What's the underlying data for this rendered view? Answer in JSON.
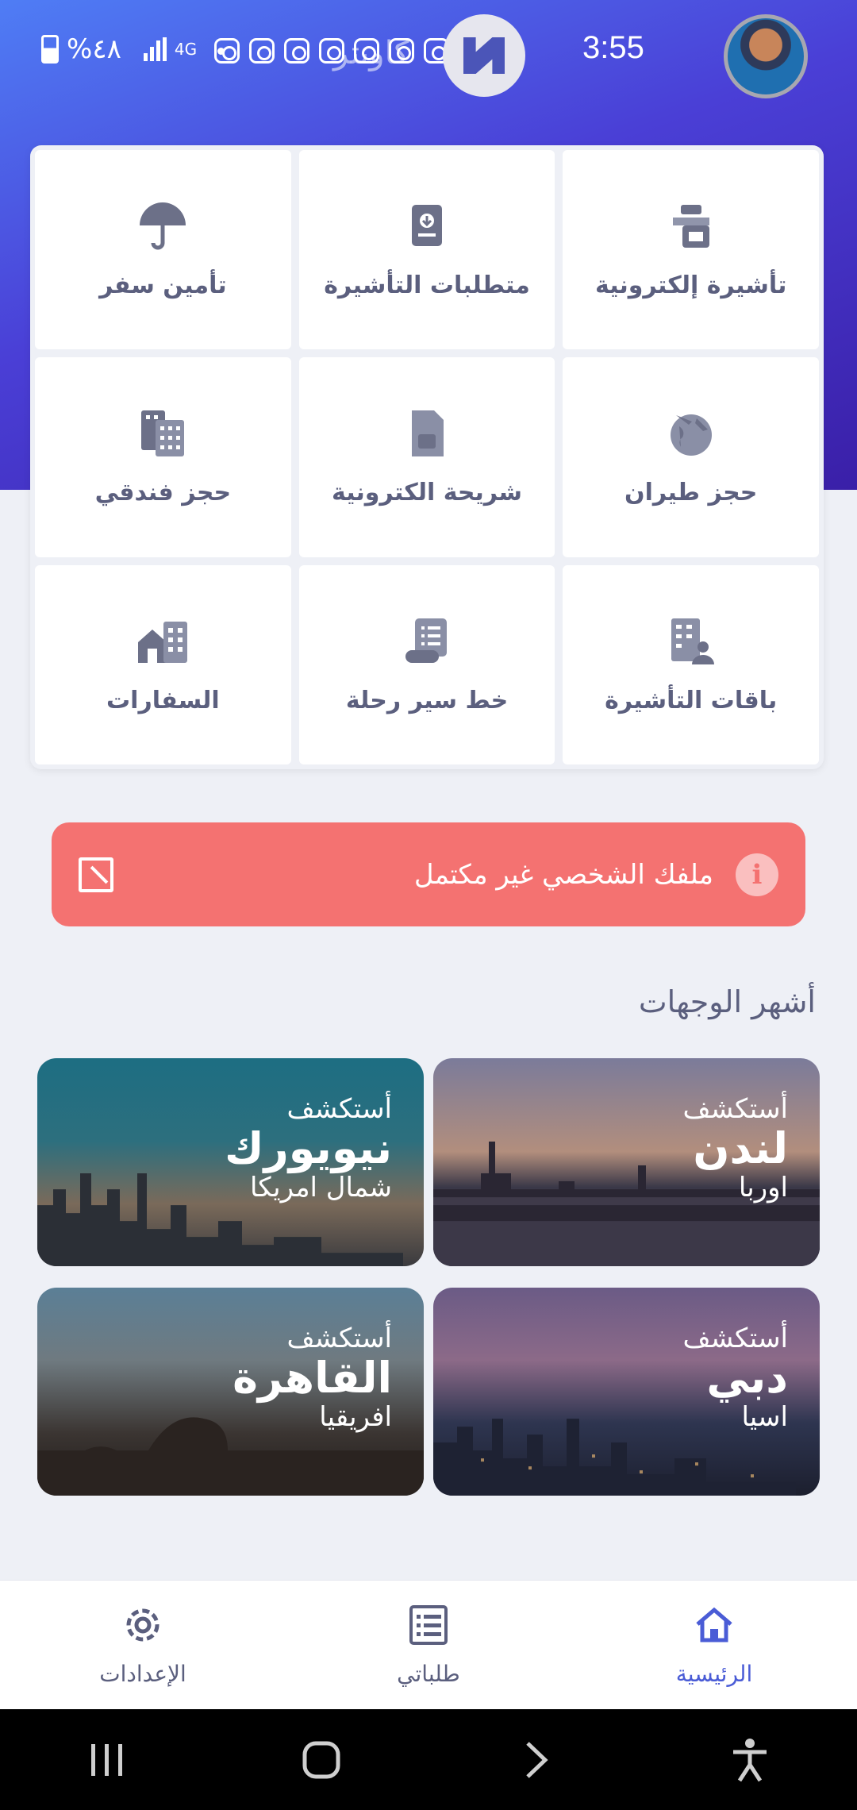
{
  "status_bar": {
    "time": "3:55",
    "battery": "%٤٨",
    "network": "4G"
  },
  "brand_ghost": "كاونتر",
  "services": [
    {
      "label": "تأشيرة إلكترونية",
      "icon": "visa-officer-icon"
    },
    {
      "label": "متطلبات التأشيرة",
      "icon": "passport-icon"
    },
    {
      "label": "تأمين سفر",
      "icon": "umbrella-icon"
    },
    {
      "label": "حجز طيران",
      "icon": "globe-plane-icon"
    },
    {
      "label": "شريحة الكترونية",
      "icon": "sim-card-icon"
    },
    {
      "label": "حجز فندقي",
      "icon": "hotel-icon"
    },
    {
      "label": "باقات التأشيرة",
      "icon": "building-user-icon"
    },
    {
      "label": "خط سير رحلة",
      "icon": "itinerary-icon"
    },
    {
      "label": "السفارات",
      "icon": "embassy-icon"
    }
  ],
  "alert": {
    "text": "ملفك الشخصي غير مكتمل",
    "info_glyph": "i",
    "color": "#f47271"
  },
  "popular": {
    "title": "أشهر الوجهات",
    "destinations": [
      {
        "explore": "أستكشف",
        "city": "لندن",
        "region": "اوربا"
      },
      {
        "explore": "أستكشف",
        "city": "نيويورك",
        "region": "شمال امريكا"
      },
      {
        "explore": "أستكشف",
        "city": "دبي",
        "region": "اسيا"
      },
      {
        "explore": "أستكشف",
        "city": "القاهرة",
        "region": "افريقيا"
      }
    ]
  },
  "bottom_nav": {
    "home": "الرئيسية",
    "requests": "طلباتي",
    "settings": "الإعدادات",
    "active_color": "#4a5cd6"
  },
  "colors": {
    "hero_start": "#4f7df5",
    "hero_end": "#3a1fa8",
    "icon": "#6c7088"
  }
}
